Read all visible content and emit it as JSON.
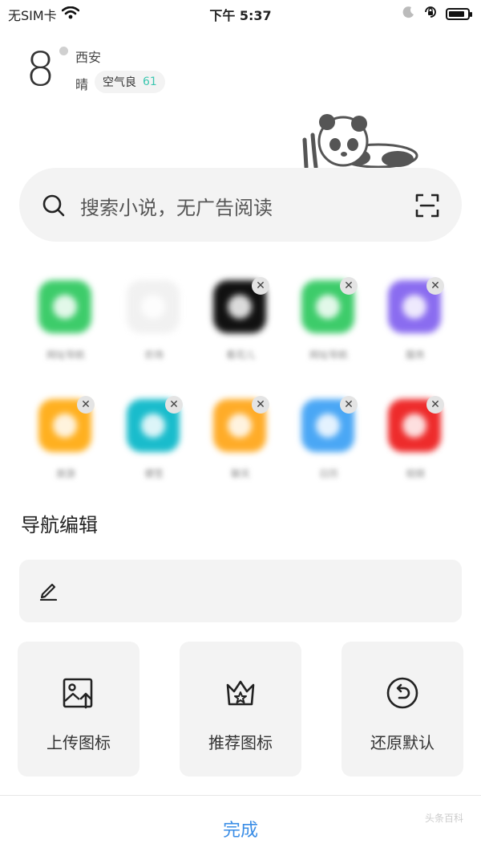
{
  "status": {
    "carrier": "无SIM卡",
    "time": "下午 5:37"
  },
  "weather": {
    "temperature": "8",
    "city": "西安",
    "condition": "晴",
    "aqi_label": "空气良",
    "aqi_value": "61"
  },
  "search": {
    "placeholder": "搜索小说，无广告阅读"
  },
  "apps": [
    {
      "label": "网址导航",
      "color": "#3dcc6a",
      "removable": false
    },
    {
      "label": "农场",
      "color": "#f1f1f1",
      "removable": false
    },
    {
      "label": "看花儿",
      "color": "#111111",
      "removable": true
    },
    {
      "label": "网址导航",
      "color": "#3dcc6a",
      "removable": true
    },
    {
      "label": "服务",
      "color": "#8a6cf0",
      "removable": true
    },
    {
      "label": "旅游",
      "color": "#ffb020",
      "removable": true
    },
    {
      "label": "便签",
      "color": "#19bccc",
      "removable": true
    },
    {
      "label": "聊天",
      "color": "#ffac28",
      "removable": true
    },
    {
      "label": "日历",
      "color": "#4aa7f5",
      "removable": true
    },
    {
      "label": "视频",
      "color": "#ee2b2b",
      "removable": true
    }
  ],
  "nav_edit": {
    "title": "导航编辑",
    "value": ""
  },
  "actions": {
    "upload": "上传图标",
    "recommend": "推荐图标",
    "restore": "还原默认"
  },
  "footer": {
    "done": "完成"
  },
  "watermark": "头条百科"
}
